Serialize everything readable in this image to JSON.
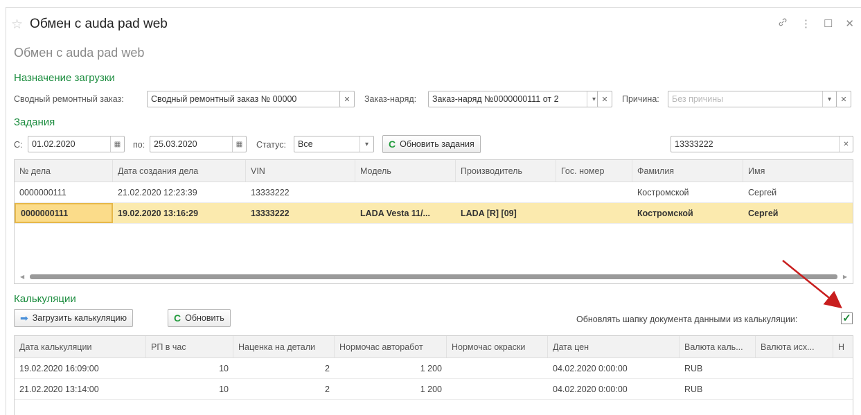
{
  "window": {
    "title": "Обмен с auda pad web",
    "subtitle": "Обмен с auda pad web",
    "star_icon": "☆",
    "link_icon": "🔗",
    "more_icon": "⋮",
    "maximize_icon": "☐",
    "close_icon": "✕"
  },
  "load_section": {
    "title": "Назначение загрузки",
    "summary_order_label": "Сводный ремонтный заказ:",
    "summary_order_value": "Сводный ремонтный заказ № 00000",
    "work_order_label": "Заказ-наряд:",
    "work_order_value": "Заказ-наряд №0000000111  от 2",
    "reason_label": "Причина:",
    "reason_placeholder": "Без причины"
  },
  "tasks_section": {
    "title": "Задания",
    "from_label": "С:",
    "from_value": "01.02.2020",
    "to_label": "по:",
    "to_value": "25.03.2020",
    "status_label": "Статус:",
    "status_value": "Все",
    "refresh_label": "Обновить задания",
    "search_value": "13333222",
    "columns": [
      "№ дела",
      "Дата создания дела",
      "VIN",
      "Модель",
      "Производитель",
      "Гос. номер",
      "Фамилия",
      "Имя"
    ],
    "rows": [
      [
        "0000000111",
        "21.02.2020 12:23:39",
        "13333222",
        "",
        "",
        "",
        "Костромской",
        "Сергей"
      ],
      [
        "0000000111",
        "19.02.2020 13:16:29",
        "13333222",
        "LADA  Vesta 11/...",
        "LADA [R] [09]",
        "",
        "Костромской",
        "Сергей"
      ]
    ]
  },
  "calc_section": {
    "title": "Калькуляции",
    "load_label": "Загрузить калькуляцию",
    "refresh_label": "Обновить",
    "update_header_label": "Обновлять шапку документа данными из калькуляции:",
    "update_header_checked": true,
    "columns": [
      "Дата калькуляции",
      "РП в час",
      "Наценка на детали",
      "Нормочас авторабот",
      "Нормочас окраски",
      "Дата цен",
      "Валюта каль...",
      "Валюта исх...",
      "Н"
    ],
    "rows": [
      [
        "19.02.2020 16:09:00",
        "10",
        "2",
        "1 200",
        "",
        "04.02.2020 0:00:00",
        "RUB",
        "",
        ""
      ],
      [
        "21.02.2020 13:14:00",
        "10",
        "2",
        "1 200",
        "",
        "04.02.2020 0:00:00",
        "RUB",
        "",
        ""
      ]
    ]
  },
  "colors": {
    "section": "#1b8c3e",
    "selected_row": "#fbeaae",
    "arrow": "#c81e1e"
  }
}
